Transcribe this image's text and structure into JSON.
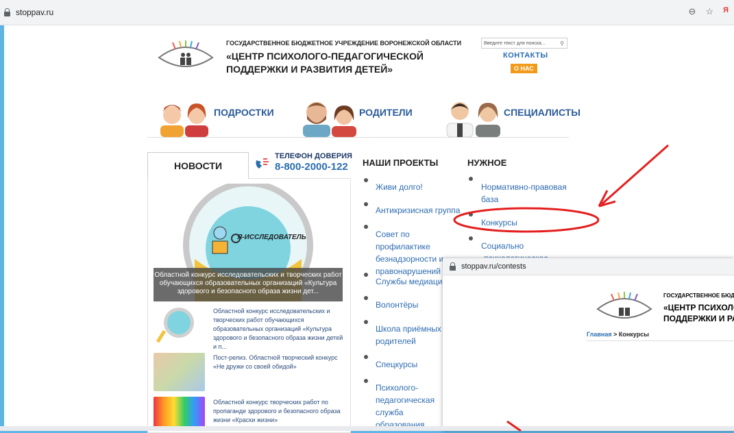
{
  "browser": {
    "url": "stoppav.ru",
    "yandex_label": "Я"
  },
  "header": {
    "org_type": "ГОСУДАРСТВЕННОЕ БЮДЖЕТНОЕ УЧРЕЖДЕНИЕ ВОРОНЕЖСКОЙ ОБЛАСТИ",
    "org_name_line1": "«ЦЕНТР ПСИХОЛОГО-ПЕДАГОГИЧЕСКОЙ",
    "org_name_line2": "ПОДДЕРЖКИ И РАЗВИТИЯ ДЕТЕЙ»",
    "search_placeholder": "Введите текст для поиска...",
    "contacts": "КОНТАКТЫ",
    "about": "О НАС"
  },
  "nav": {
    "teens": "ПОДРОСТКИ",
    "parents": "РОДИТЕЛИ",
    "specialists": "СПЕЦИАЛИСТЫ"
  },
  "news": {
    "tab": "НОВОСТИ",
    "hotline_title": "ТЕЛЕФОН ДОВЕРИЯ",
    "hotline_number": "8-800-2000-122",
    "feature_logo_text": "Я-ИССЛЕДОВАТЕЛЬ",
    "feature_caption": "Областной конкурс исследовательских и творческих работ обучающихся образовательных организаций «Культура здорового и безопасного образа жизни дет...",
    "items": [
      "Областной конкурс исследовательских и творческих работ обучающихся образовательных организаций «Культура здорового и безопасного образа жизни детей и п...",
      "Пост-релиз. Областной творческий конкурс «Не дружи со своей обидой»",
      "Областной конкурс творческих работ по пропаганде здорового и безопасного образа жизни «Краски жизни»"
    ]
  },
  "projects": {
    "title": "НАШИ ПРОЕКТЫ",
    "items": [
      "Живи долго!",
      "Антикризисная группа",
      "Совет по профилактике безнадзорности и правонарушений",
      "Службы медиации",
      "Волонтёры",
      "Школа приёмных родителей",
      "Спецкурсы",
      "Психолого-педагогическая служба образования Воронежской обл..."
    ]
  },
  "useful": {
    "title": "НУЖНОЕ",
    "items": [
      "Нормативно-правовая база",
      "Конкурсы",
      "Социально -психологическое"
    ]
  },
  "popup": {
    "url": "stoppav.ru/contests",
    "org_type": "ГОСУДАРСТВЕННОЕ БЮДЖЕТНОЕ УЧРЕЖДЕНИЕ",
    "org_name_line1": "«ЦЕНТР ПСИХОЛОГО-ПЕДАГОГИЧЕСКОЙ",
    "org_name_line2": "ПОДДЕРЖКИ И РАЗВИТИЯ ДЕТЕЙ»",
    "breadcrumb_home": "Главная",
    "breadcrumb_sep": " > ",
    "breadcrumb_current": "Конкурсы"
  },
  "colors": {
    "accent": "#2a6db0",
    "annotation": "#e41e1e",
    "about_bg": "#f29b1b"
  }
}
